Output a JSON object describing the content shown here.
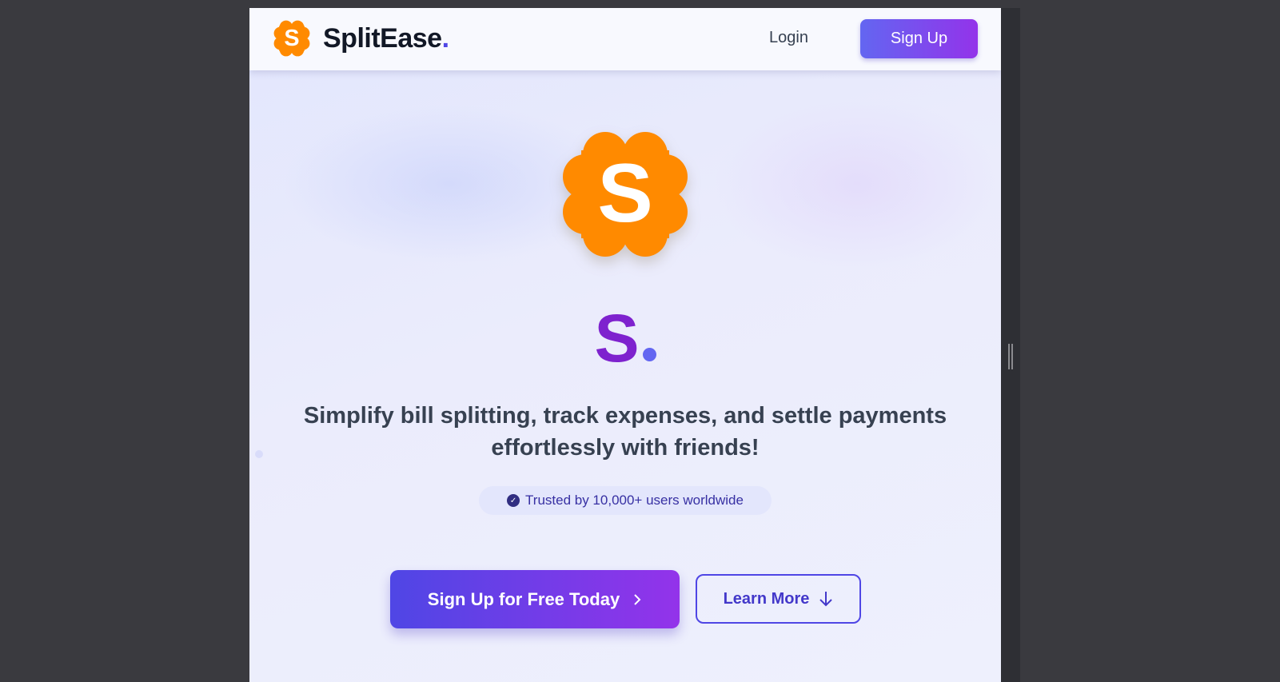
{
  "header": {
    "brand": "SplitEase",
    "brand_dot": ".",
    "login": "Login",
    "signup": "Sign Up"
  },
  "hero": {
    "logo_letter": "S",
    "title": "S",
    "title_dot": ".",
    "tagline": "Simplify bill splitting, track expenses, and settle payments effortlessly with friends!",
    "trust_badge": "Trusted by 10,000+ users worldwide",
    "cta_primary": "Sign Up for Free Today",
    "cta_secondary": "Learn More"
  },
  "colors": {
    "brand_orange": "#ff8a00",
    "accent_indigo": "#4f46e5",
    "accent_purple": "#9333ea"
  }
}
